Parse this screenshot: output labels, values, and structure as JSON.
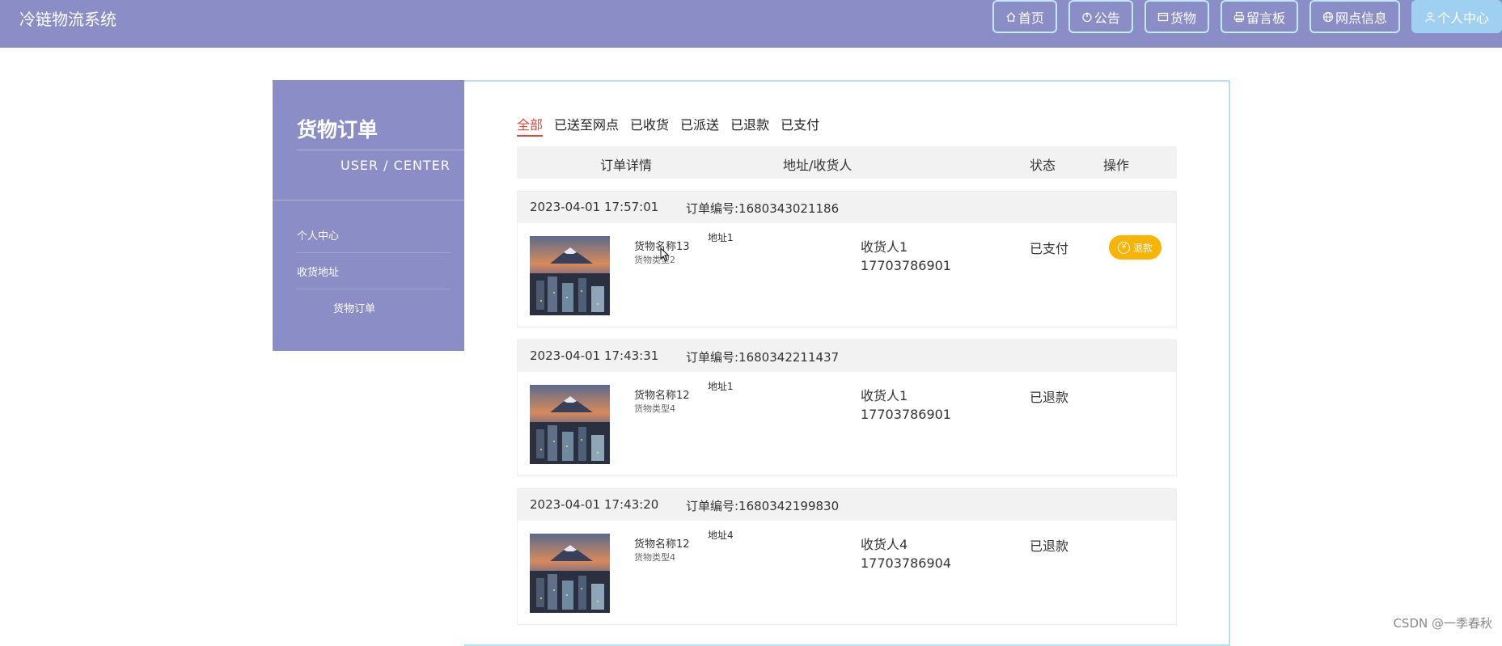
{
  "app": {
    "title": "冷链物流系统"
  },
  "nav": [
    {
      "label": "首页",
      "icon": "home-icon"
    },
    {
      "label": "公告",
      "icon": "power-icon"
    },
    {
      "label": "货物",
      "icon": "package-icon"
    },
    {
      "label": "留言板",
      "icon": "printer-icon"
    },
    {
      "label": "网点信息",
      "icon": "globe-icon"
    },
    {
      "label": "个人中心",
      "icon": "user-icon"
    }
  ],
  "sidebar": {
    "title": "货物订单",
    "subtitle": "USER / CENTER",
    "items": [
      {
        "label": "个人中心"
      },
      {
        "label": "收货地址"
      },
      {
        "label": "货物订单"
      }
    ]
  },
  "tabs": [
    {
      "label": "全部"
    },
    {
      "label": "已送至网点"
    },
    {
      "label": "已收货"
    },
    {
      "label": "已派送"
    },
    {
      "label": "已退款"
    },
    {
      "label": "已支付"
    }
  ],
  "table": {
    "headers": [
      "订单详情",
      "地址/收货人",
      "状态",
      "操作"
    ]
  },
  "orders": [
    {
      "time": "2023-04-01 17:57:01",
      "order_no": "订单编号:1680343021186",
      "goods_name": "货物名称13",
      "goods_type": "货物类型2",
      "address": "地址1",
      "receiver": "收货人1",
      "phone": "17703786901",
      "status": "已支付",
      "action": "退款"
    },
    {
      "time": "2023-04-01 17:43:31",
      "order_no": "订单编号:1680342211437",
      "goods_name": "货物名称12",
      "goods_type": "货物类型4",
      "address": "地址1",
      "receiver": "收货人1",
      "phone": "17703786901",
      "status": "已退款",
      "action": ""
    },
    {
      "time": "2023-04-01 17:43:20",
      "order_no": "订单编号:1680342199830",
      "goods_name": "货物名称12",
      "goods_type": "货物类型4",
      "address": "地址4",
      "receiver": "收货人4",
      "phone": "17703786904",
      "status": "已退款",
      "action": ""
    }
  ],
  "colors": {
    "header_bg": "#8a8dc6",
    "active_tab": "#e5483f",
    "refund_button": "#f8b400",
    "active_nav": "#9fd0f2"
  },
  "watermark": "CSDN @一季春秋"
}
